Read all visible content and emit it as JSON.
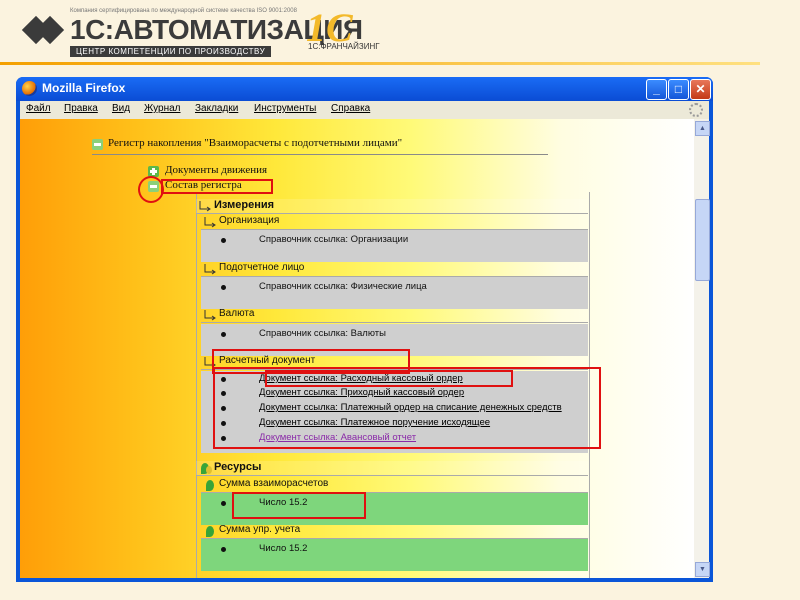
{
  "header": {
    "certificate_text": "Компания сертифицирована по международной системе качества ISO 9001:2008",
    "logo_title": "1С:АВТОМАТИЗАЦИЯ",
    "logo_subtitle": "ЦЕНТР КОМПЕТЕНЦИИ ПО ПРОИЗВОДСТВУ",
    "franchise_logo": "1С",
    "franchise_text": "1С:ФРАНЧАЙЗИНГ"
  },
  "window": {
    "title": "Mozilla Firefox",
    "buttons": {
      "minimize": "_",
      "maximize": "□",
      "close": "✕"
    }
  },
  "menu": [
    "Файл",
    "Правка",
    "Вид",
    "Журнал",
    "Закладки",
    "Инструменты",
    "Справка"
  ],
  "register": {
    "title": "Регистр накопления \"Взаиморасчеты с подотчетными лицами\"",
    "node_documents": "Документы движения",
    "node_structure": "Состав регистра"
  },
  "dimensions": {
    "title": "Измерения",
    "groups": [
      {
        "name": "Организация",
        "items": [
          {
            "text": "Справочник ссылка: Организации",
            "type": "plain"
          }
        ]
      },
      {
        "name": "Подотчетное лицо",
        "items": [
          {
            "text": "Справочник ссылка: Физические лица",
            "type": "plain"
          }
        ]
      },
      {
        "name": "Валюта",
        "items": [
          {
            "text": "Справочник ссылка: Валюты",
            "type": "plain"
          }
        ]
      },
      {
        "name": "Расчетный документ",
        "items": [
          {
            "text": "Документ ссылка: Расходный кассовый ордер",
            "type": "link"
          },
          {
            "text": "Документ ссылка: Приходный кассовый ордер",
            "type": "link"
          },
          {
            "text": "Документ ссылка: Платежный ордер на списание денежных средств",
            "type": "link"
          },
          {
            "text": "Документ ссылка: Платежное поручение исходящее",
            "type": "link"
          },
          {
            "text": "Документ ссылка: Авансовый отчет",
            "type": "visited"
          }
        ]
      }
    ]
  },
  "resources": {
    "title": "Ресурсы",
    "groups": [
      {
        "name": "Сумма взаиморасчетов",
        "items": [
          {
            "text": "Число 15.2",
            "type": "plain"
          }
        ]
      },
      {
        "name": "Сумма упр. учета",
        "items": [
          {
            "text": "Число 15.2",
            "type": "plain"
          }
        ]
      }
    ]
  },
  "colors": {
    "highlight": "#e01010",
    "dimension_values_bg": "#cfcfcf",
    "resource_values_bg": "#7ed67c",
    "visited_link": "#8a2aa8",
    "titlebar": "#0a55d8"
  }
}
